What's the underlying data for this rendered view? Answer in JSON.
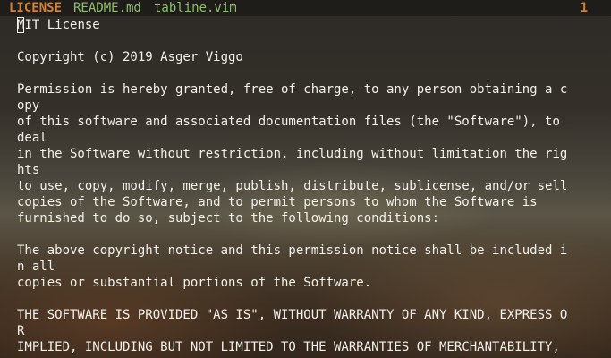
{
  "tabline": {
    "tabs": [
      {
        "label": "LICENSE",
        "active": true
      },
      {
        "label": "README.md",
        "active": false
      },
      {
        "label": "tabline.vim",
        "active": false
      }
    ],
    "tab_count": "1"
  },
  "buffer": {
    "lines": [
      "MIT License",
      "",
      "Copyright (c) 2019 Asger Viggo",
      "",
      "Permission is hereby granted, free of charge, to any person obtaining a c",
      "opy",
      "of this software and associated documentation files (the \"Software\"), to",
      "deal",
      "in the Software without restriction, including without limitation the rig",
      "hts",
      "to use, copy, modify, merge, publish, distribute, sublicense, and/or sell",
      "copies of the Software, and to permit persons to whom the Software is",
      "furnished to do so, subject to the following conditions:",
      "",
      "The above copyright notice and this permission notice shall be included i",
      "n all",
      "copies or substantial portions of the Software.",
      "",
      "THE SOFTWARE IS PROVIDED \"AS IS\", WITHOUT WARRANTY OF ANY KIND, EXPRESS O",
      "R",
      "IMPLIED, INCLUDING BUT NOT LIMITED TO THE WARRANTIES OF MERCHANTABILITY,"
    ]
  },
  "colors": {
    "active_tab": "#d7802e",
    "inactive_tab": "#8fbf6a",
    "text": "#f4f1ea"
  }
}
